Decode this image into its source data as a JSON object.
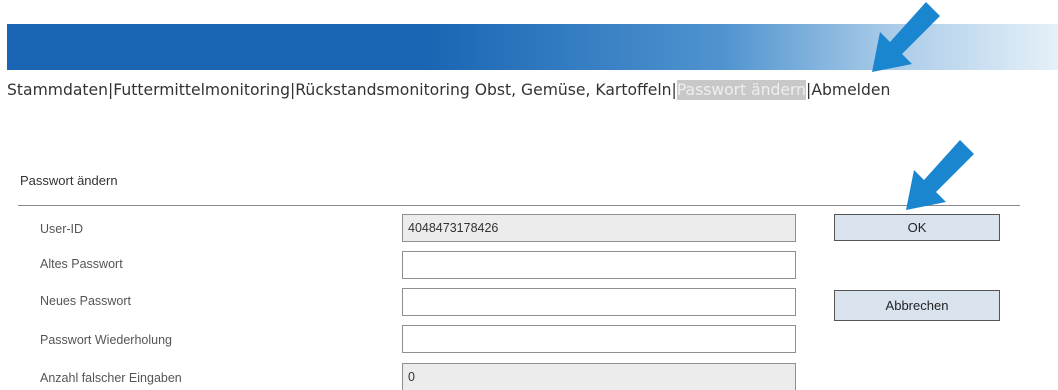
{
  "nav": {
    "items": [
      "Stammdaten",
      "Futtermittelmonitoring",
      "Rückstandsmonitoring Obst, Gemüse, Kartoffeln",
      "Passwort ändern",
      "Abmelden"
    ],
    "separator": "|",
    "active_index": 3
  },
  "form": {
    "title": "Passwort ändern",
    "fields": [
      {
        "label": "User-ID",
        "value": "4048473178426",
        "readonly": true
      },
      {
        "label": "Altes Passwort",
        "value": "",
        "readonly": false
      },
      {
        "label": "Neues Passwort",
        "value": "",
        "readonly": false
      },
      {
        "label": "Passwort Wiederholung",
        "value": "",
        "readonly": false
      },
      {
        "label": "Anzahl falscher Eingaben",
        "value": "0",
        "readonly": true
      }
    ]
  },
  "buttons": {
    "ok": "OK",
    "cancel": "Abbrechen"
  },
  "annotations": [
    {
      "icon": "arrow-down-left-icon",
      "color": "#1a86d0"
    },
    {
      "icon": "arrow-down-left-icon",
      "color": "#1a86d0"
    }
  ],
  "colors": {
    "banner_dark": "#1a66b4",
    "banner_light": "#e6f0f8",
    "button_bg": "#d9e3ee",
    "active_nav_bg": "#c8c8c8"
  }
}
